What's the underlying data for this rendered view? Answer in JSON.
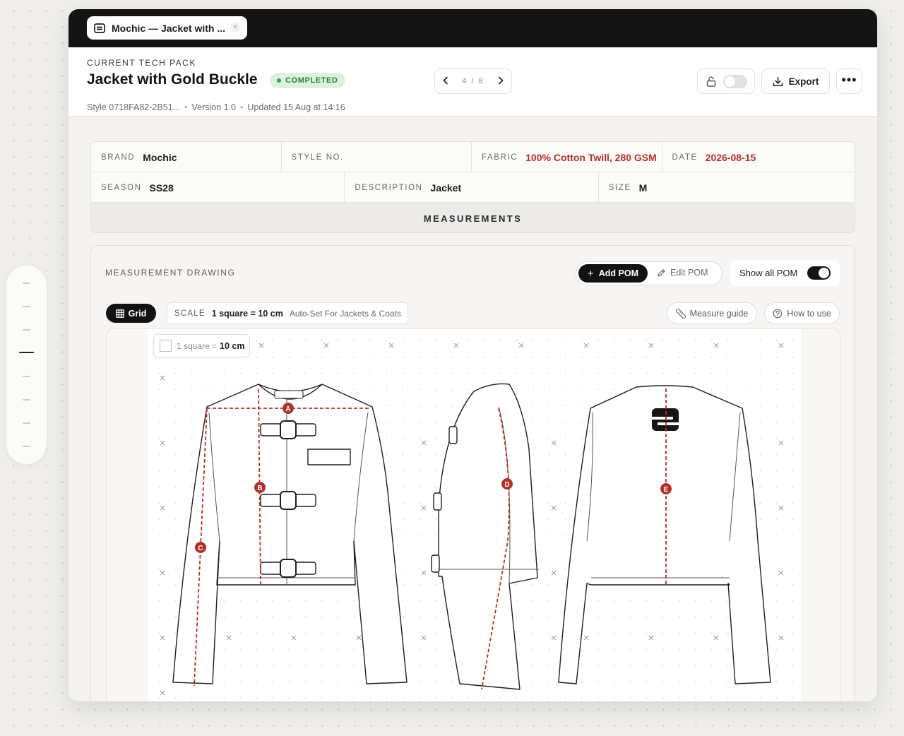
{
  "tab": {
    "title": "Mochic — Jacket with ...",
    "close": "×"
  },
  "header": {
    "eyebrow": "CURRENT TECH PACK",
    "title": "Jacket with Gold Buckle",
    "status": "COMPLETED",
    "style": "Style 0718FA82-2B51...",
    "version": "Version 1.0",
    "updated": "Updated 15 Aug at 14:16",
    "separator": "•",
    "pager": {
      "text": "4 / 8",
      "current": 4,
      "total": 8
    },
    "lock_enabled": false,
    "export_label": "Export",
    "more_label": "•••"
  },
  "info": {
    "brand": {
      "label": "BRAND",
      "value": "Mochic"
    },
    "style_no": {
      "label": "STYLE NO.",
      "value": ""
    },
    "fabric": {
      "label": "FABRIC",
      "value": "100% Cotton Twill, 280 GSM"
    },
    "date": {
      "label": "DATE",
      "value": "2026-08-15"
    },
    "season": {
      "label": "SEASON",
      "value": "SS28"
    },
    "description": {
      "label": "DESCRIPTION",
      "value": "Jacket"
    },
    "size": {
      "label": "SIZE",
      "value": "M"
    },
    "section": "MEASUREMENTS"
  },
  "drawing": {
    "title": "MEASUREMENT DRAWING",
    "add_pom": "Add POM",
    "edit_pom": "Edit POM",
    "show_all_pom": "Show all POM",
    "show_all_enabled": true,
    "grid_label": "Grid",
    "scale_label": "SCALE",
    "scale_value": "1 square = 10 cm",
    "scale_note": "Auto-Set For Jackets & Coats",
    "measure_guide": "Measure guide",
    "how_to_use": "How to use",
    "legend_prefix": "1 square =",
    "legend_value": "10 cm",
    "pom_markers": [
      "A",
      "B",
      "C",
      "D",
      "E"
    ]
  },
  "colors": {
    "accent_red": "#b2322b",
    "status_green": "#2e7d3b",
    "dark": "#121212"
  },
  "icons": [
    "document-icon",
    "chevron-left-icon",
    "chevron-right-icon",
    "lock-icon",
    "download-icon",
    "more-icon",
    "plus-icon",
    "pencil-icon",
    "grid-icon",
    "ruler-icon",
    "help-circle-icon"
  ]
}
